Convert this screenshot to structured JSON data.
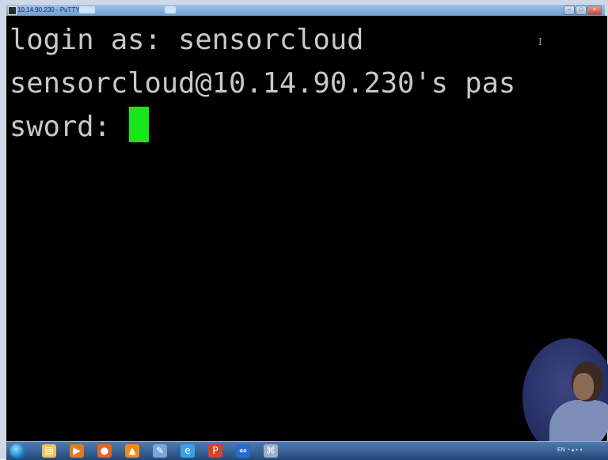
{
  "window": {
    "title": "10.14.90.230 - PuTTY"
  },
  "terminal": {
    "lines": [
      "login as: sensorcloud",
      "sensorcloud@10.14.90.230's pas",
      "sword: "
    ],
    "cursor_color": "#19e619",
    "text_color": "#c8c8c8",
    "background": "#000000"
  },
  "taskbar": {
    "icons": [
      {
        "name": "windows-start-icon"
      },
      {
        "name": "folder-icon",
        "glyph": "▤",
        "color": "#e8c45a"
      },
      {
        "name": "media-player-icon",
        "glyph": "▶",
        "color": "#e07a2a"
      },
      {
        "name": "firefox-icon",
        "glyph": "●",
        "color": "#e2682a"
      },
      {
        "name": "vlc-icon",
        "glyph": "▲",
        "color": "#f08a1a"
      },
      {
        "name": "paint-icon",
        "glyph": "✎",
        "color": "#7aa7d8"
      },
      {
        "name": "internet-explorer-icon",
        "glyph": "e",
        "color": "#3aa0e8"
      },
      {
        "name": "powerpoint-icon",
        "glyph": "P",
        "color": "#d2452a"
      },
      {
        "name": "teamviewer-icon",
        "glyph": "⇔",
        "color": "#2a6ad0"
      },
      {
        "name": "putty-icon",
        "glyph": "⌘",
        "color": "#9ab0c8"
      }
    ],
    "tray_text": "EN"
  }
}
